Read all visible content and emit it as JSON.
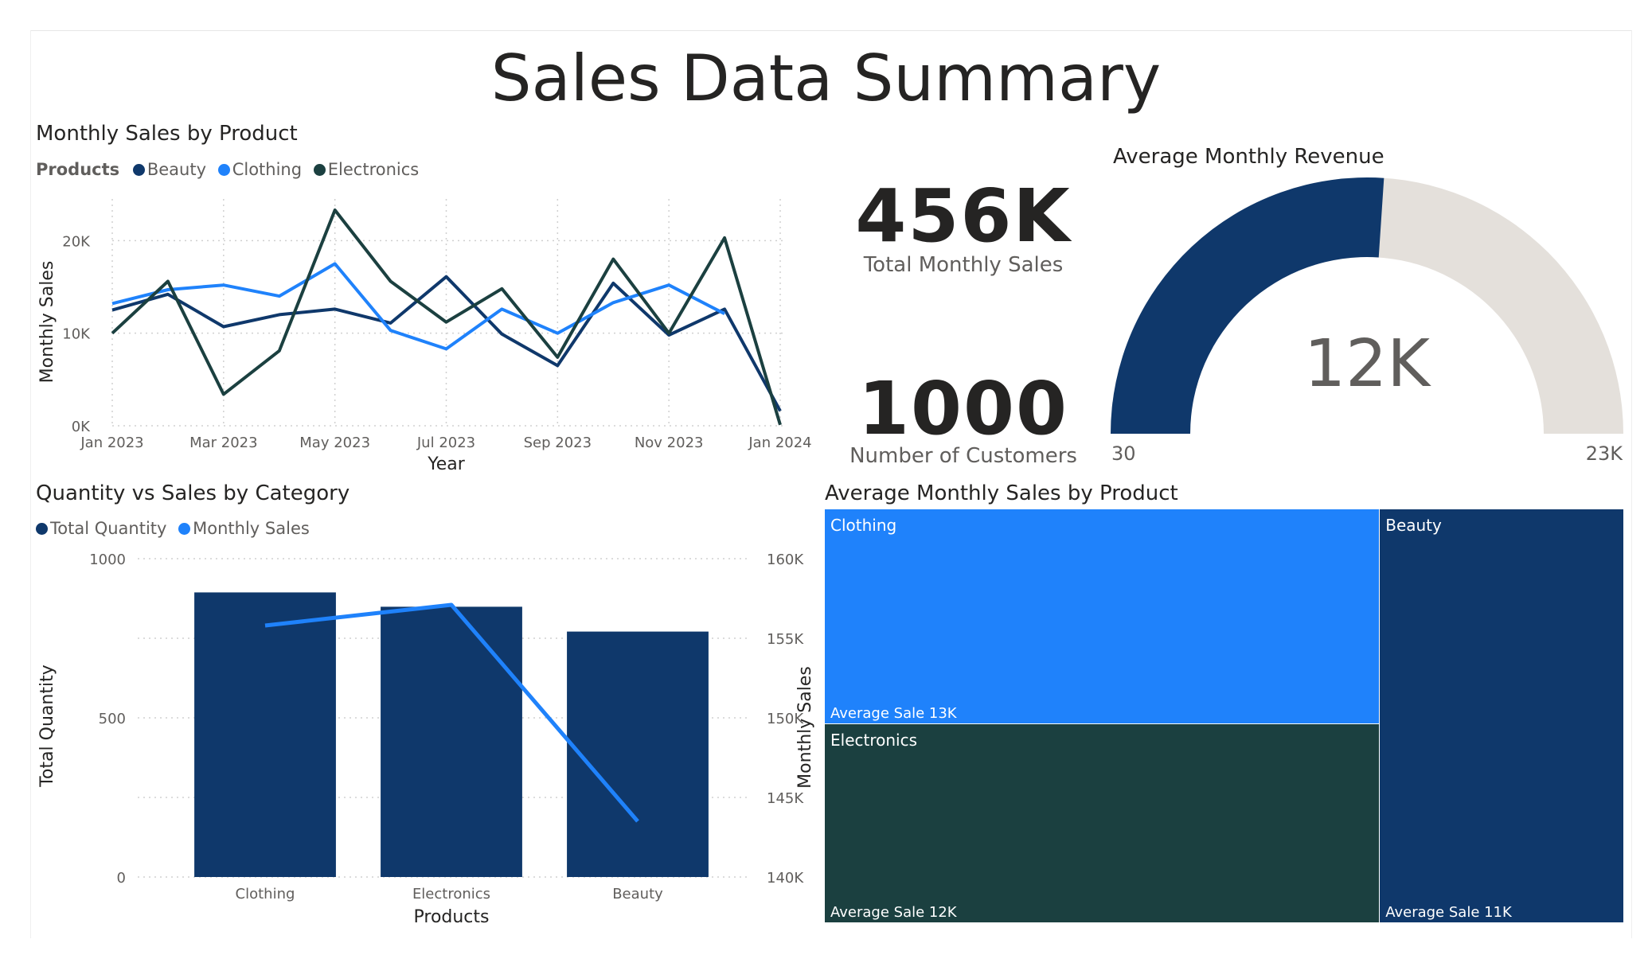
{
  "page": {
    "title": "Sales Data Summary"
  },
  "colors": {
    "beauty": "#0f386b",
    "clothing": "#1f82fb",
    "electronics": "#1b4040",
    "grid": "#d0d0d0",
    "gauge_track": "#e4e0db"
  },
  "line_chart": {
    "title": "Monthly Sales by Product",
    "legend_title": "Products"
  },
  "kpis": {
    "total_sales": {
      "value": "456K",
      "label": "Total Monthly Sales"
    },
    "customers": {
      "value": "1000",
      "label": "Number of Customers"
    }
  },
  "gauge": {
    "title": "Average Monthly Revenue",
    "value_label": "12K",
    "min_label": "30",
    "max_label": "23K"
  },
  "combo_chart": {
    "title": "Quantity vs Sales by Category"
  },
  "treemap": {
    "title": "Average Monthly Sales by Product"
  },
  "chart_data": [
    {
      "type": "line",
      "title": "Monthly Sales by Product",
      "xlabel": "Year",
      "ylabel": "Monthly Sales",
      "legend_title": "Products",
      "legend_position": "top-left",
      "x": [
        "2023-01",
        "2023-02",
        "2023-03",
        "2023-04",
        "2023-05",
        "2023-06",
        "2023-07",
        "2023-08",
        "2023-09",
        "2023-10",
        "2023-11",
        "2023-12",
        "2024-01"
      ],
      "x_tick_labels": [
        "Jan 2023",
        "Mar 2023",
        "May 2023",
        "Jul 2023",
        "Sep 2023",
        "Nov 2023",
        "Jan 2024"
      ],
      "y_tick_labels": [
        "0K",
        "10K",
        "20K"
      ],
      "ylim": [
        0,
        24500
      ],
      "grid": true,
      "series": [
        {
          "name": "Beauty",
          "color": "#0f386b",
          "values": [
            12500,
            14200,
            10700,
            12000,
            12600,
            11100,
            16100,
            9900,
            6500,
            15400,
            9800,
            12600,
            1600
          ]
        },
        {
          "name": "Clothing",
          "color": "#1f82fb",
          "values": [
            13200,
            14700,
            15200,
            14000,
            17500,
            10300,
            8300,
            12600,
            10000,
            13300,
            15200,
            12100,
            null
          ]
        },
        {
          "name": "Electronics",
          "color": "#1b4040",
          "values": [
            10000,
            15600,
            3400,
            8100,
            23300,
            15600,
            11200,
            14800,
            7400,
            18000,
            10000,
            20300,
            100
          ]
        }
      ]
    },
    {
      "type": "gauge",
      "title": "Average Monthly Revenue",
      "value": 12000,
      "min": 30,
      "max": 23000,
      "value_label": "12K",
      "min_label": "30",
      "max_label": "23K"
    },
    {
      "type": "bar",
      "title": "Quantity vs Sales by Category",
      "xlabel": "Products",
      "ylabel": "Total Quantity",
      "y2label": "Monthly Sales",
      "categories": [
        "Clothing",
        "Electronics",
        "Beauty"
      ],
      "series": [
        {
          "name": "Total Quantity",
          "kind": "bar",
          "axis": "left",
          "color": "#0f386b",
          "values": [
            894,
            849,
            771
          ]
        },
        {
          "name": "Monthly Sales",
          "kind": "line",
          "axis": "right",
          "color": "#1f82fb",
          "values": [
            155800,
            157100,
            143500
          ]
        }
      ],
      "ylim": [
        0,
        1000
      ],
      "y2lim": [
        140000,
        160000
      ],
      "y_tick_labels": [
        "0",
        "500",
        "1000"
      ],
      "y2_tick_labels": [
        "140K",
        "145K",
        "150K",
        "155K",
        "160K"
      ],
      "legend_position": "top-left",
      "grid": true
    },
    {
      "type": "treemap",
      "title": "Average Monthly Sales by Product",
      "value_label": "Average Sale",
      "items": [
        {
          "name": "Clothing",
          "value": 13000,
          "display": "Average Sale 13K",
          "color": "#1f82fb"
        },
        {
          "name": "Electronics",
          "value": 12000,
          "display": "Average Sale 12K",
          "color": "#1b4040"
        },
        {
          "name": "Beauty",
          "value": 11000,
          "display": "Average Sale 11K",
          "color": "#0f386b"
        }
      ]
    }
  ]
}
